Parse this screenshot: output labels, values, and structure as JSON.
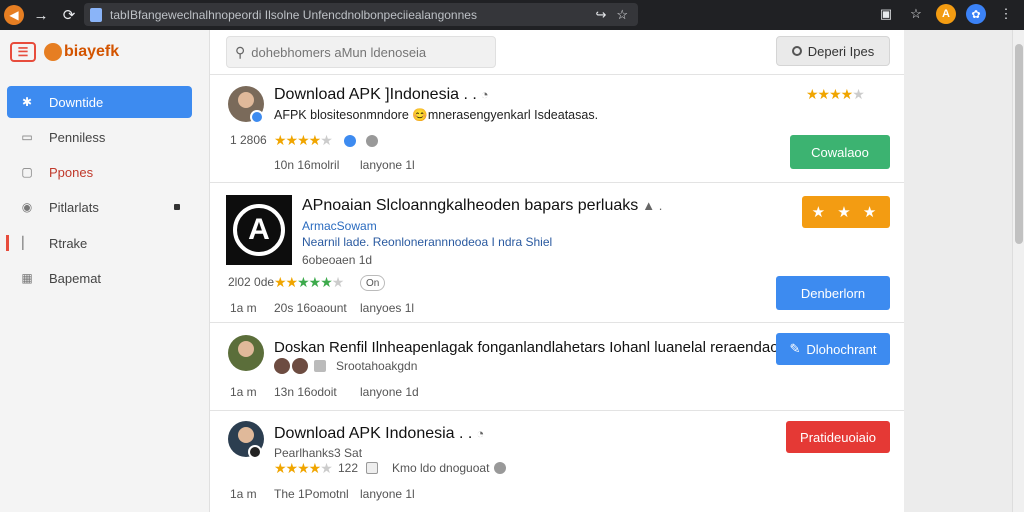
{
  "browser": {
    "url": "tabIBfangeweclnalhnopeordi Ilsolne Unfencdnolbonpeciiealangonnes",
    "icons": [
      "back-icon",
      "forward-icon",
      "reload-icon",
      "bookmark-icon",
      "profile-icon",
      "star-icon"
    ],
    "ext_a": "A"
  },
  "sidebar": {
    "logo_text": "biayefk",
    "items": [
      {
        "label": "Downtide",
        "icon": "gear-icon"
      },
      {
        "label": "Penniless",
        "icon": "chat-icon"
      },
      {
        "label": "Ppones",
        "icon": "inbox-icon"
      },
      {
        "label": "Pitlarlats",
        "icon": "pin-icon"
      },
      {
        "label": "Rtrake",
        "icon": "flag-icon"
      },
      {
        "label": "Bapemat",
        "icon": "grid-icon"
      }
    ]
  },
  "header": {
    "search_placeholder": "dohebhomers aMun ldenoseia",
    "top_button": "Deperi Ipes"
  },
  "cards": [
    {
      "title": "Download APK ]Indonesia . .",
      "subtitle": "AFPK blositesonmndore 😊mnerasengyenkarl Isdeatasas.",
      "count": "1 2806",
      "meta_a": "10n 16molril",
      "meta_b": "lanyone 1l",
      "rating": "4.5",
      "button": "Cowalaoo"
    },
    {
      "title": "APnoaian Slcloanngkalheoden bapars perluaks",
      "subtitle": "ArmacSowam",
      "subtitle2": "Nearnil lade. Reonlonerannnodeoa I ndra Shiel",
      "subtitle3": "6obeoaen 1d",
      "count": "2l02 0de",
      "pill": "On",
      "meta_a": "20s 16oaount",
      "meta_b": "lanyoes 1l",
      "meta_c": "1a m",
      "button_stars": "★ ★ ★",
      "button": "Denberlorn"
    },
    {
      "title": "Doskan Renfil Ilnheapenlagak fonganlandlahetars Iohanl luanelal reraendaoe. .",
      "subtitle": "Srootahoakgdn",
      "meta_a": "13n 16odoit",
      "meta_b": "lanyone 1d",
      "meta_c": "1a m",
      "button": "Dlohochrant"
    },
    {
      "title": "Download APK Indonesia . .",
      "subtitle": "Pearlhanks3 Sat",
      "count": "122",
      "meta_extra": "Kmo ldo dnoguoat",
      "meta_a": "The 1Pomotnl",
      "meta_b": "lanyone 1l",
      "meta_c": "1a m",
      "button": "Pratideuoiaio"
    }
  ]
}
